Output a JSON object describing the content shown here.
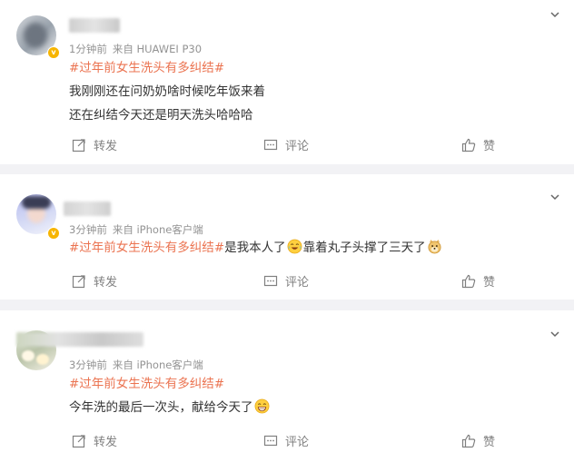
{
  "colors": {
    "topic": "#eb7350",
    "meta": "#939393",
    "badge": "#f7b500",
    "separator": "#f2f2f5"
  },
  "comments": [
    {
      "time": "1分钟前",
      "source": "来自 HUAWEI P30",
      "topic": "#过年前女生洗头有多纠结#",
      "lines": [
        "我刚刚还在问奶奶啥时候吃年饭来着",
        "还在纠结今天还是明天洗头哈哈哈"
      ],
      "actions": {
        "repost": "转发",
        "comment": "评论",
        "like": "赞"
      }
    },
    {
      "time": "3分钟前",
      "source": "来自 iPhone客户端",
      "topic": "#过年前女生洗头有多纠结#",
      "text_a": "是我本人了",
      "text_b": "靠着丸子头撑了三天了",
      "emoji_a": "laughing-tears-emoji",
      "emoji_b": "doge-emoji",
      "actions": {
        "repost": "转发",
        "comment": "评论",
        "like": "赞"
      }
    },
    {
      "time": "3分钟前",
      "source": "来自 iPhone客户端",
      "topic": "#过年前女生洗头有多纠结#",
      "text": "今年洗的最后一次头，献给今天了",
      "emoji": "grinning-emoji",
      "actions": {
        "repost": "转发",
        "comment": "评论",
        "like": "赞"
      }
    }
  ]
}
